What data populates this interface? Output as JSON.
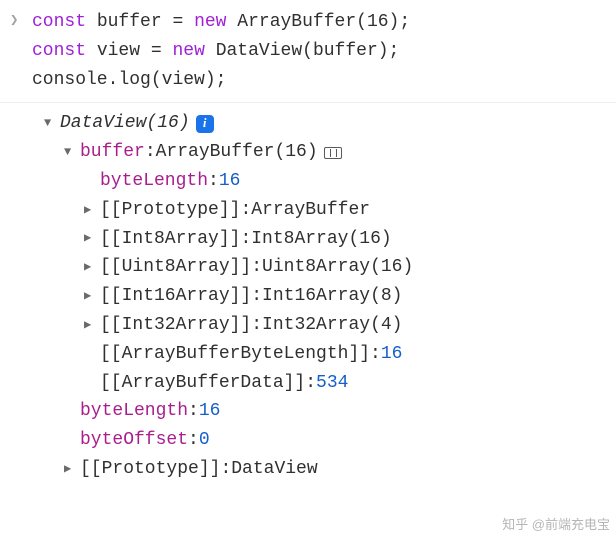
{
  "code": {
    "line1": {
      "kw1": "const",
      "var1": "buffer",
      "op1": "=",
      "kw2": "new",
      "cls1": "ArrayBuffer",
      "p1": "(",
      "num1": "16",
      "p2": ");"
    },
    "line2": {
      "kw1": "const",
      "var1": "view",
      "op1": "=",
      "kw2": "new",
      "cls1": "DataView",
      "p1": "(",
      "arg1": "buffer",
      "p2": ");"
    },
    "line3": {
      "obj": "console",
      "dot": ".",
      "method": "log",
      "p1": "(",
      "arg1": "view",
      "p2": ");"
    }
  },
  "tree": {
    "root": "DataView(16)",
    "buffer": {
      "key": "buffer",
      "val": "ArrayBuffer(16)"
    },
    "byteLengthInner": {
      "key": "byteLength",
      "val": "16"
    },
    "protoAB": {
      "key": "[[Prototype]]",
      "val": "ArrayBuffer"
    },
    "int8": {
      "key": "[[Int8Array]]",
      "val": "Int8Array(16)"
    },
    "uint8": {
      "key": "[[Uint8Array]]",
      "val": "Uint8Array(16)"
    },
    "int16": {
      "key": "[[Int16Array]]",
      "val": "Int16Array(8)"
    },
    "int32": {
      "key": "[[Int32Array]]",
      "val": "Int32Array(4)"
    },
    "abbl": {
      "key": "[[ArrayBufferByteLength]]",
      "val": "16"
    },
    "abd": {
      "key": "[[ArrayBufferData]]",
      "val": "534"
    },
    "byteLength": {
      "key": "byteLength",
      "val": "16"
    },
    "byteOffset": {
      "key": "byteOffset",
      "val": "0"
    },
    "protoDV": {
      "key": "[[Prototype]]",
      "val": "DataView"
    }
  },
  "watermark": "知乎 @前端充电宝"
}
